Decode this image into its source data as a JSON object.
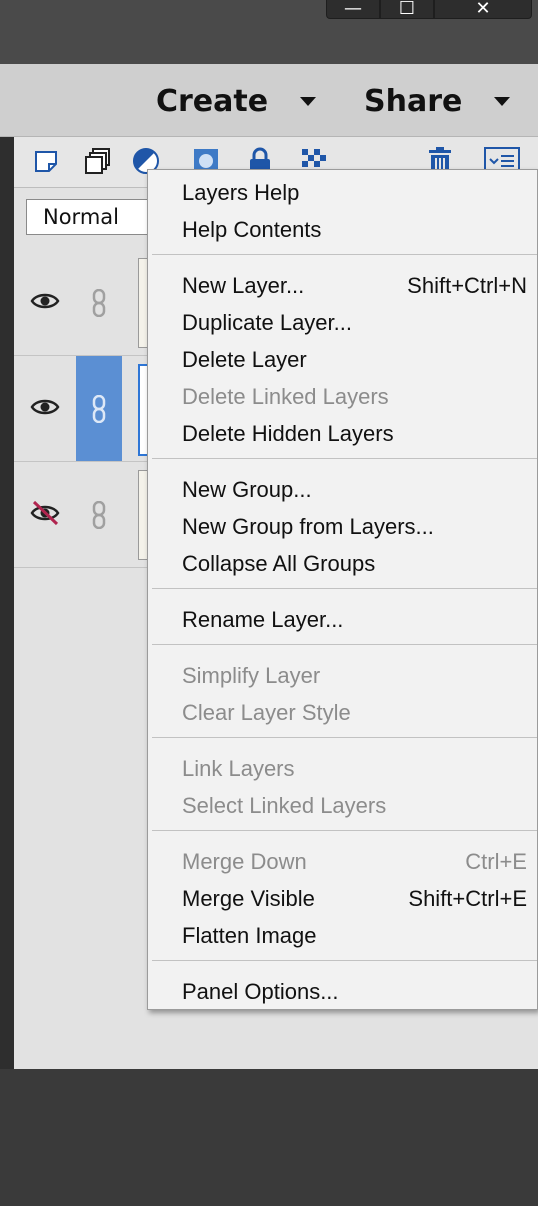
{
  "window_controls": {
    "minimize": "—",
    "maximize": "☐",
    "close": "✕"
  },
  "header": {
    "create_label": "Create",
    "share_label": "Share"
  },
  "toolbar": {
    "icons": [
      "new-layer-icon",
      "new-group-icon",
      "adjustment-layer-icon",
      "layer-mask-icon",
      "lock-icon",
      "lock-transparency-icon",
      "trash-icon",
      "panel-menu-icon"
    ],
    "accent_color": "#2e76d6"
  },
  "blend_mode": {
    "selected": "Normal"
  },
  "layers": [
    {
      "visible": true,
      "selected": false
    },
    {
      "visible": true,
      "selected": true
    },
    {
      "visible": false,
      "selected": false
    }
  ],
  "context_menu": {
    "groups": [
      [
        {
          "label": "Layers Help",
          "shortcut": "",
          "disabled": false
        },
        {
          "label": "Help Contents",
          "shortcut": "",
          "disabled": false
        }
      ],
      [
        {
          "label": "New Layer...",
          "shortcut": "Shift+Ctrl+N",
          "disabled": false
        },
        {
          "label": "Duplicate Layer...",
          "shortcut": "",
          "disabled": false
        },
        {
          "label": "Delete Layer",
          "shortcut": "",
          "disabled": false
        },
        {
          "label": "Delete Linked Layers",
          "shortcut": "",
          "disabled": true
        },
        {
          "label": "Delete Hidden Layers",
          "shortcut": "",
          "disabled": false
        }
      ],
      [
        {
          "label": "New Group...",
          "shortcut": "",
          "disabled": false
        },
        {
          "label": "New Group from Layers...",
          "shortcut": "",
          "disabled": false
        },
        {
          "label": "Collapse All Groups",
          "shortcut": "",
          "disabled": false
        }
      ],
      [
        {
          "label": "Rename Layer...",
          "shortcut": "",
          "disabled": false
        }
      ],
      [
        {
          "label": "Simplify Layer",
          "shortcut": "",
          "disabled": true
        },
        {
          "label": "Clear Layer Style",
          "shortcut": "",
          "disabled": true
        }
      ],
      [
        {
          "label": "Link Layers",
          "shortcut": "",
          "disabled": true
        },
        {
          "label": "Select Linked Layers",
          "shortcut": "",
          "disabled": true
        }
      ],
      [
        {
          "label": "Merge Down",
          "shortcut": "Ctrl+E",
          "disabled": true
        },
        {
          "label": "Merge Visible",
          "shortcut": "Shift+Ctrl+E",
          "disabled": false
        },
        {
          "label": "Flatten Image",
          "shortcut": "",
          "disabled": false
        }
      ],
      [
        {
          "label": "Panel Options...",
          "shortcut": "",
          "disabled": false
        }
      ]
    ]
  }
}
